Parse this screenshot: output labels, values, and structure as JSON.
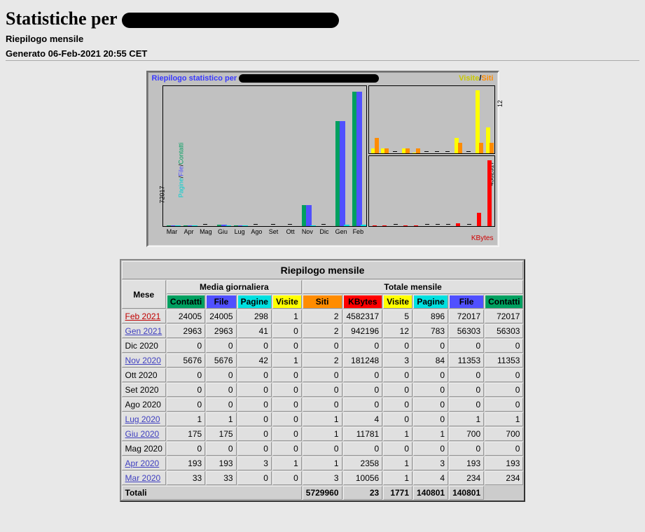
{
  "header": {
    "title_prefix": "Statistiche per ",
    "subtitle": "Riepilogo mensile",
    "generated": "Generato 06-Feb-2021 20:55 CET"
  },
  "chart": {
    "title_prefix": "Riepilogo statistico per ",
    "legend_visite": "Visite",
    "legend_siti": "Siti",
    "legend_pagine": "Pagine",
    "legend_file": "File",
    "legend_contatti": "Contatti",
    "y_left_max": "72017",
    "y_right_top": "12",
    "y_right_bot": "4582317",
    "kb_label": "KBytes",
    "months": [
      "Mar",
      "Apr",
      "Mag",
      "Giu",
      "Lug",
      "Ago",
      "Set",
      "Ott",
      "Nov",
      "Dic",
      "Gen",
      "Feb"
    ]
  },
  "table": {
    "title": "Riepilogo mensile",
    "col_mese": "Mese",
    "group_media": "Media giornaliera",
    "group_totale": "Totale mensile",
    "h": {
      "contatti": "Contatti",
      "file": "File",
      "pagine": "Pagine",
      "visite": "Visite",
      "siti": "Siti",
      "kbytes": "KBytes"
    },
    "rows": [
      {
        "month": "Feb 2021",
        "link": true,
        "current": true,
        "mc": 24005,
        "mf": 24005,
        "mp": 298,
        "mv": 1,
        "siti": 2,
        "kb": 4582317,
        "tv": 5,
        "tp": 896,
        "tf": 72017,
        "tc": 72017
      },
      {
        "month": "Gen 2021",
        "link": true,
        "mc": 2963,
        "mf": 2963,
        "mp": 41,
        "mv": 0,
        "siti": 2,
        "kb": 942196,
        "tv": 12,
        "tp": 783,
        "tf": 56303,
        "tc": 56303
      },
      {
        "month": "Dic 2020",
        "link": false,
        "mc": 0,
        "mf": 0,
        "mp": 0,
        "mv": 0,
        "siti": 0,
        "kb": 0,
        "tv": 0,
        "tp": 0,
        "tf": 0,
        "tc": 0
      },
      {
        "month": "Nov 2020",
        "link": true,
        "mc": 5676,
        "mf": 5676,
        "mp": 42,
        "mv": 1,
        "siti": 2,
        "kb": 181248,
        "tv": 3,
        "tp": 84,
        "tf": 11353,
        "tc": 11353
      },
      {
        "month": "Ott 2020",
        "link": false,
        "mc": 0,
        "mf": 0,
        "mp": 0,
        "mv": 0,
        "siti": 0,
        "kb": 0,
        "tv": 0,
        "tp": 0,
        "tf": 0,
        "tc": 0
      },
      {
        "month": "Set 2020",
        "link": false,
        "mc": 0,
        "mf": 0,
        "mp": 0,
        "mv": 0,
        "siti": 0,
        "kb": 0,
        "tv": 0,
        "tp": 0,
        "tf": 0,
        "tc": 0
      },
      {
        "month": "Ago 2020",
        "link": false,
        "mc": 0,
        "mf": 0,
        "mp": 0,
        "mv": 0,
        "siti": 0,
        "kb": 0,
        "tv": 0,
        "tp": 0,
        "tf": 0,
        "tc": 0
      },
      {
        "month": "Lug 2020",
        "link": true,
        "mc": 1,
        "mf": 1,
        "mp": 0,
        "mv": 0,
        "siti": 1,
        "kb": 4,
        "tv": 0,
        "tp": 0,
        "tf": 1,
        "tc": 1
      },
      {
        "month": "Giu 2020",
        "link": true,
        "mc": 175,
        "mf": 175,
        "mp": 0,
        "mv": 0,
        "siti": 1,
        "kb": 11781,
        "tv": 1,
        "tp": 1,
        "tf": 700,
        "tc": 700
      },
      {
        "month": "Mag 2020",
        "link": false,
        "mc": 0,
        "mf": 0,
        "mp": 0,
        "mv": 0,
        "siti": 0,
        "kb": 0,
        "tv": 0,
        "tp": 0,
        "tf": 0,
        "tc": 0
      },
      {
        "month": "Apr 2020",
        "link": true,
        "mc": 193,
        "mf": 193,
        "mp": 3,
        "mv": 1,
        "siti": 1,
        "kb": 2358,
        "tv": 1,
        "tp": 3,
        "tf": 193,
        "tc": 193
      },
      {
        "month": "Mar 2020",
        "link": true,
        "mc": 33,
        "mf": 33,
        "mp": 0,
        "mv": 0,
        "siti": 3,
        "kb": 10056,
        "tv": 1,
        "tp": 4,
        "tf": 234,
        "tc": 234
      }
    ],
    "totals": {
      "label": "Totali",
      "kb": 5729960,
      "tv": 23,
      "tp": 1771,
      "tf": 140801,
      "tc": 140801
    }
  },
  "chart_data": {
    "type": "bar",
    "title": "Riepilogo statistico",
    "categories": [
      "Mar 2020",
      "Apr 2020",
      "Mag 2020",
      "Giu 2020",
      "Lug 2020",
      "Ago 2020",
      "Set 2020",
      "Ott 2020",
      "Nov 2020",
      "Dic 2020",
      "Gen 2021",
      "Feb 2021"
    ],
    "series": [
      {
        "name": "Contatti (totale)",
        "values": [
          234,
          193,
          0,
          700,
          1,
          0,
          0,
          0,
          11353,
          0,
          56303,
          72017
        ]
      },
      {
        "name": "File (totale)",
        "values": [
          234,
          193,
          0,
          700,
          1,
          0,
          0,
          0,
          11353,
          0,
          56303,
          72017
        ]
      },
      {
        "name": "Pagine (totale)",
        "values": [
          4,
          3,
          0,
          1,
          0,
          0,
          0,
          0,
          84,
          0,
          783,
          896
        ]
      },
      {
        "name": "Visite (totale)",
        "values": [
          1,
          1,
          0,
          1,
          0,
          0,
          0,
          0,
          3,
          0,
          12,
          5
        ]
      },
      {
        "name": "Siti",
        "values": [
          3,
          1,
          0,
          1,
          1,
          0,
          0,
          0,
          2,
          0,
          2,
          2
        ]
      },
      {
        "name": "KBytes",
        "values": [
          10056,
          2358,
          0,
          11781,
          4,
          0,
          0,
          0,
          181248,
          0,
          942196,
          4582317
        ]
      }
    ],
    "y_left_max": 72017,
    "y_right_top_max": 12,
    "y_right_bot_max": 4582317
  }
}
